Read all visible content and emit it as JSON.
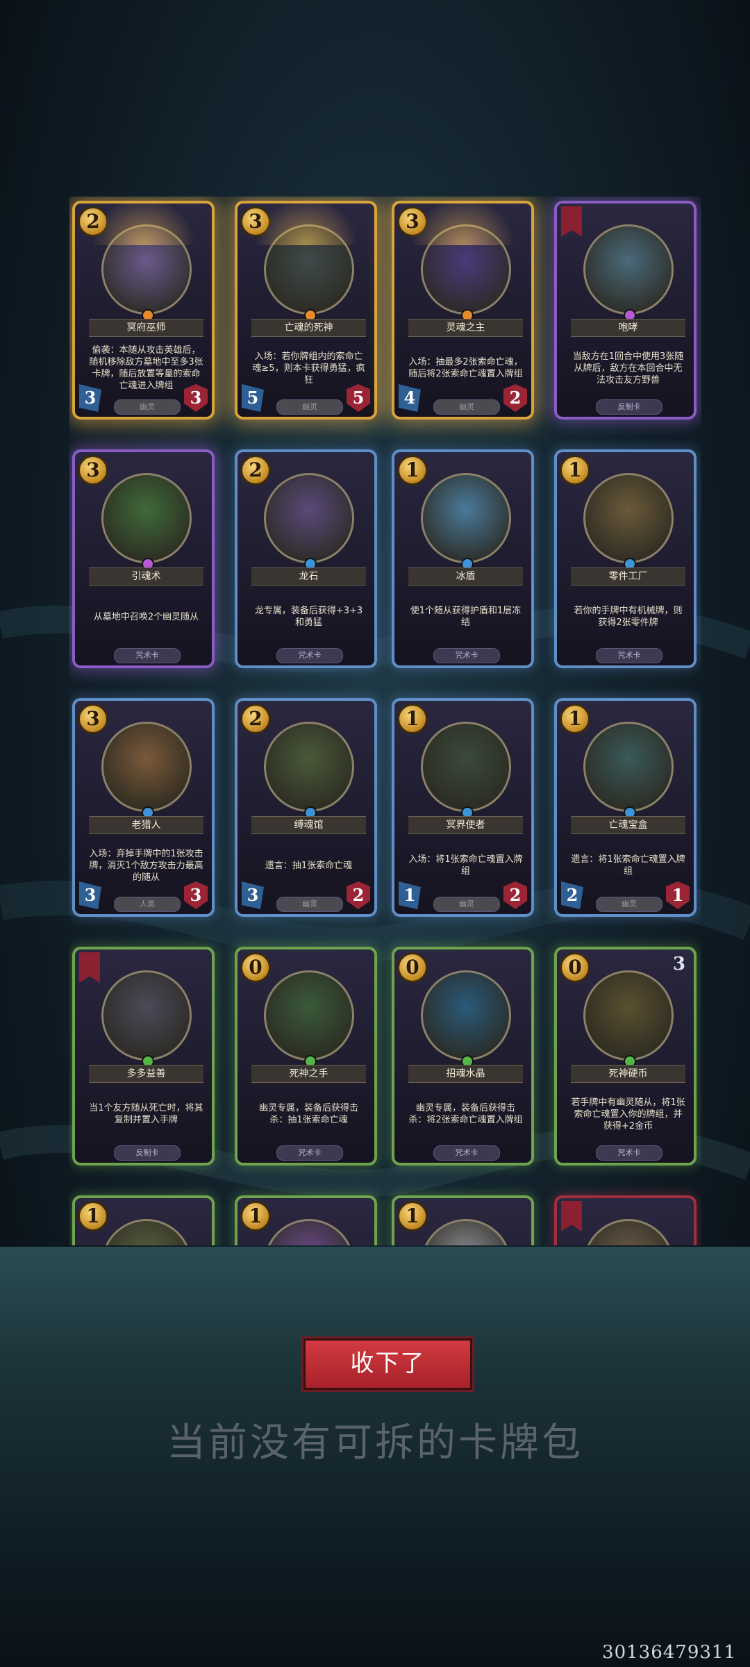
{
  "cards": [
    {
      "name": "冥府巫师",
      "cost": "2",
      "frame": "gold",
      "gem": "orange",
      "desc": "偷袭：本随从攻击英雄后，随机移除敌方墓地中至多3张卡牌，随后放置等量的索命亡魂进入牌组",
      "type": "幽灵",
      "type_faded": true,
      "atk": "3",
      "hp": "3",
      "art": "#6a5a8c"
    },
    {
      "name": "亡魂的死神",
      "cost": "3",
      "frame": "gold",
      "gem": "orange",
      "desc": "入场：若你牌组内的索命亡魂≥5，则本卡获得勇猛，疯狂",
      "type": "幽灵",
      "type_faded": true,
      "atk": "5",
      "hp": "5",
      "art": "#3f4a4a"
    },
    {
      "name": "灵魂之主",
      "cost": "3",
      "frame": "gold",
      "gem": "orange",
      "desc": "入场：抽最多2张索命亡魂，随后将2张索命亡魂置入牌组",
      "type": "幽灵",
      "type_faded": true,
      "atk": "4",
      "hp": "2",
      "art": "#4a3a7a"
    },
    {
      "name": "咆哮",
      "cost": "",
      "frame": "purple",
      "gem": "purple",
      "desc": "当敌方在1回合中使用3张随从牌后，敌方在本回合中无法攻击友方野兽",
      "type": "反制卡",
      "type_faded": false,
      "atk": "",
      "hp": "",
      "art": "#4a6a7a"
    },
    {
      "name": "引魂术",
      "cost": "3",
      "frame": "purple",
      "gem": "purple",
      "desc": "从墓地中召唤2个幽灵随从",
      "type": "咒术卡",
      "type_faded": false,
      "atk": "",
      "hp": "",
      "art": "#3f6a3a"
    },
    {
      "name": "龙石",
      "cost": "2",
      "frame": "blue",
      "gem": "blue",
      "desc": "龙专属，装备后获得+3+3和勇猛",
      "type": "咒术卡",
      "type_faded": false,
      "atk": "",
      "hp": "",
      "art": "#5a4a7a"
    },
    {
      "name": "冰盾",
      "cost": "1",
      "frame": "blue",
      "gem": "blue",
      "desc": "使1个随从获得护盾和1层冻结",
      "type": "咒术卡",
      "type_faded": false,
      "atk": "",
      "hp": "",
      "art": "#4a7a9a"
    },
    {
      "name": "零件工厂",
      "cost": "1",
      "frame": "blue",
      "gem": "blue",
      "desc": "若你的手牌中有机械牌，则获得2张零件牌",
      "type": "咒术卡",
      "type_faded": false,
      "atk": "",
      "hp": "",
      "art": "#6a5a3a"
    },
    {
      "name": "老猎人",
      "cost": "3",
      "frame": "blue",
      "gem": "blue",
      "desc": "入场：弃掉手牌中的1张攻击牌，消灭1个敌方攻击力最高的随从",
      "type": "人类",
      "type_faded": true,
      "atk": "3",
      "hp": "3",
      "art": "#7a5a3a"
    },
    {
      "name": "缚魂馆",
      "cost": "2",
      "frame": "blue",
      "gem": "blue",
      "desc": "遗言：抽1张索命亡魂",
      "type": "幽灵",
      "type_faded": true,
      "atk": "3",
      "hp": "2",
      "art": "#4a5a3a"
    },
    {
      "name": "冥界使者",
      "cost": "1",
      "frame": "blue",
      "gem": "blue",
      "desc": "入场：将1张索命亡魂置入牌组",
      "type": "幽灵",
      "type_faded": true,
      "atk": "1",
      "hp": "2",
      "art": "#3a4a3a"
    },
    {
      "name": "亡魂宝盒",
      "cost": "1",
      "frame": "blue",
      "gem": "blue",
      "desc": "遗言：将1张索命亡魂置入牌组",
      "type": "幽灵",
      "type_faded": true,
      "atk": "2",
      "hp": "1",
      "art": "#3a5a5a"
    },
    {
      "name": "多多益善",
      "cost": "",
      "frame": "green",
      "gem": "green",
      "desc": "当1个友方随从死亡时，将其复制并置入手牌",
      "type": "反制卡",
      "type_faded": false,
      "atk": "",
      "hp": "",
      "art": "#4a4a5a"
    },
    {
      "name": "死神之手",
      "cost": "0",
      "frame": "green",
      "gem": "green",
      "desc": "幽灵专属，装备后获得击杀：抽1张索命亡魂",
      "type": "咒术卡",
      "type_faded": false,
      "atk": "",
      "hp": "",
      "art": "#3a5a3a"
    },
    {
      "name": "招魂水晶",
      "cost": "0",
      "frame": "green",
      "gem": "green",
      "desc": "幽灵专属，装备后获得击杀：将2张索命亡魂置入牌组",
      "type": "咒术卡",
      "type_faded": false,
      "atk": "",
      "hp": "",
      "art": "#2a5a7a"
    },
    {
      "name": "死神硬币",
      "cost": "0",
      "frame": "green",
      "gem": "green",
      "desc": "若手牌中有幽灵随从，将1张索命亡魂置入你的牌组，并获得+2金币",
      "type": "咒术卡",
      "type_faded": false,
      "atk": "",
      "hp": "",
      "art": "#5a5030",
      "count": "3"
    },
    {
      "name": "",
      "cost": "1",
      "frame": "green",
      "gem": "green",
      "desc": "",
      "type": "",
      "type_faded": false,
      "atk": "",
      "hp": "",
      "art": "#5a6040"
    },
    {
      "name": "",
      "cost": "1",
      "frame": "green",
      "gem": "green",
      "desc": "",
      "type": "",
      "type_faded": false,
      "atk": "",
      "hp": "",
      "art": "#6a4a8a"
    },
    {
      "name": "",
      "cost": "1",
      "frame": "green",
      "gem": "green",
      "desc": "",
      "type": "",
      "type_faded": false,
      "atk": "",
      "hp": "",
      "art": "#8a8a90"
    },
    {
      "name": "",
      "cost": "",
      "frame": "red",
      "gem": "green",
      "desc": "",
      "type": "",
      "type_faded": false,
      "atk": "",
      "hp": "",
      "art": "#6a5a4a"
    }
  ],
  "collect_button": "收下了",
  "notice": "当前没有可拆的卡牌包",
  "user_id": "30136479311",
  "colors": {
    "accent": "#c52a33",
    "gold": "#d8a43a",
    "blue_frame": "#5f8fc6",
    "green_frame": "#6fa34d",
    "purple_frame": "#8a5cc5"
  }
}
